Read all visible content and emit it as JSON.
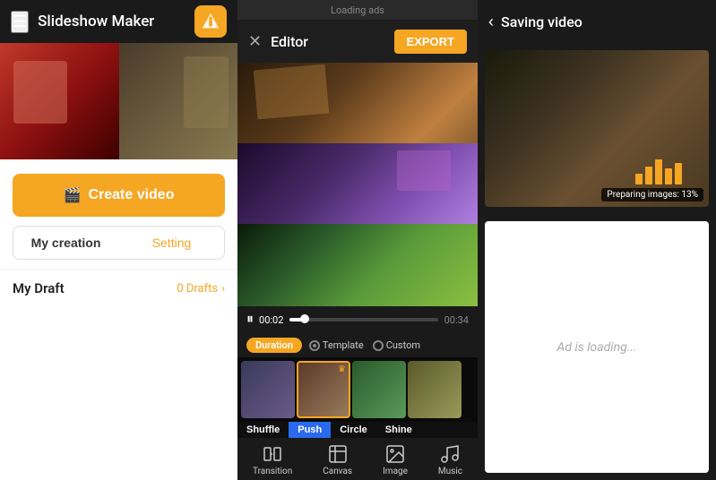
{
  "app": {
    "title": "Slideshow Maker"
  },
  "top_bar": {
    "loading_ads": "Loading ads"
  },
  "left_panel": {
    "header_title": "Slideshow Maker",
    "create_btn": "Create video",
    "tab_my_creation": "My creation",
    "tab_setting": "Setting",
    "draft_label": "My Draft",
    "draft_count": "0 Drafts"
  },
  "editor": {
    "title": "Editor",
    "export_label": "EXPORT",
    "time_current": "00:02",
    "time_total": "00:34",
    "duration_label": "Duration",
    "option_template": "Template",
    "option_custom": "Custom",
    "transition_tabs": [
      "Shuffle",
      "Push",
      "Circle",
      "Shine"
    ],
    "active_transition": "Push",
    "tools": [
      {
        "name": "Transition",
        "icon": "transition"
      },
      {
        "name": "Canvas",
        "icon": "canvas"
      },
      {
        "name": "Image",
        "icon": "image"
      },
      {
        "name": "Music",
        "icon": "music"
      }
    ]
  },
  "saving": {
    "title": "Saving video",
    "preparing_text": "Preparing images: 13%",
    "ad_loading_text": "Ad is loading..."
  },
  "chart_bars": [
    12,
    20,
    28,
    18,
    24
  ],
  "progress_percent": 10
}
